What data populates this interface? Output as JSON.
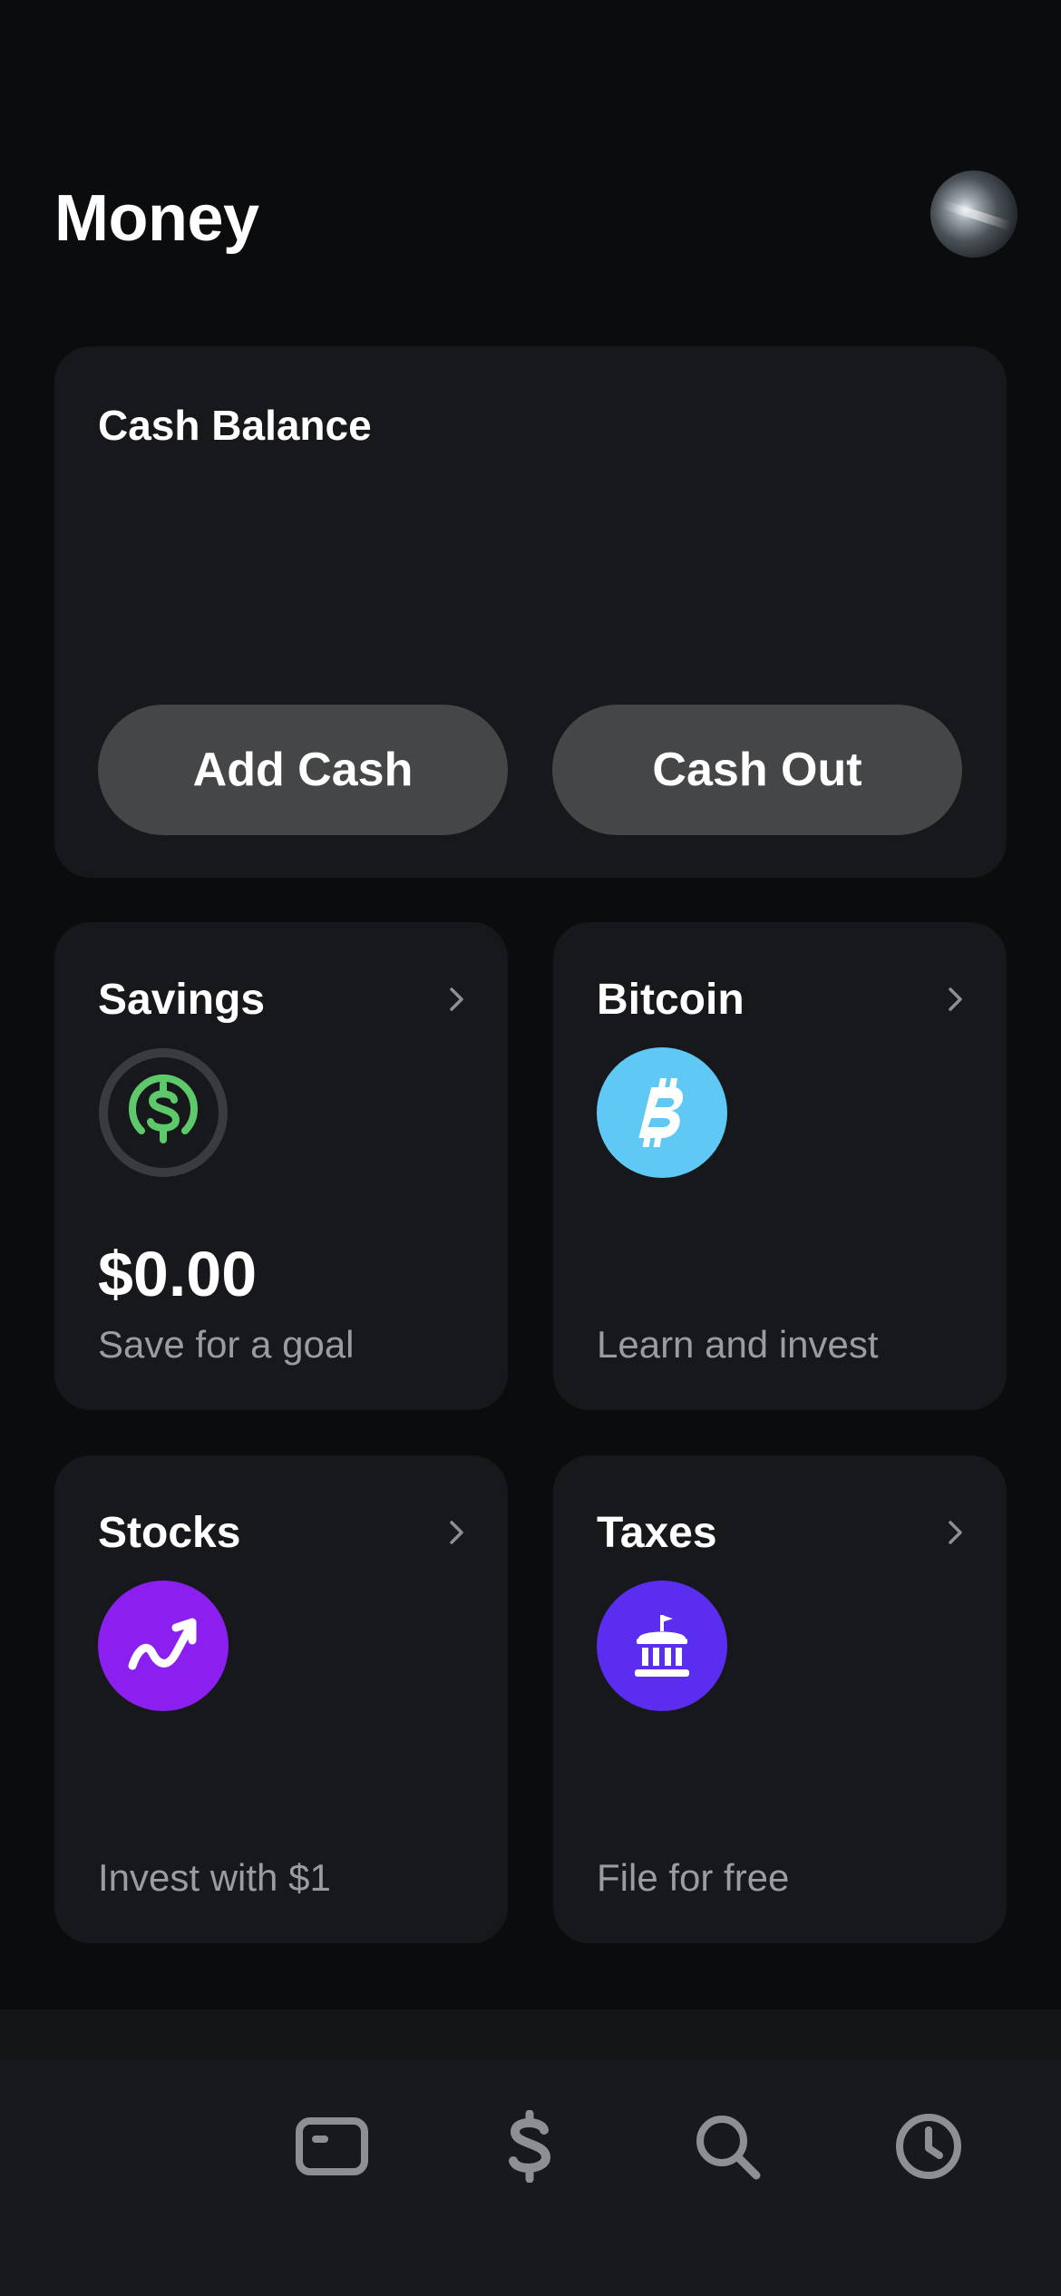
{
  "header": {
    "title": "Money"
  },
  "balance_card": {
    "title": "Cash Balance",
    "add_cash_label": "Add Cash",
    "cash_out_label": "Cash Out"
  },
  "tiles": [
    {
      "title": "Savings",
      "amount": "$0.00",
      "subtitle": "Save for a goal",
      "icon": "savings-dollar-icon",
      "icon_color": "#5ec96a"
    },
    {
      "title": "Bitcoin",
      "amount": "",
      "subtitle": "Learn and invest",
      "icon": "bitcoin-icon",
      "icon_color": "#5fc8f5"
    },
    {
      "title": "Stocks",
      "amount": "",
      "subtitle": "Invest with $1",
      "icon": "stocks-trend-icon",
      "icon_color": "#8a1ff0"
    },
    {
      "title": "Taxes",
      "amount": "",
      "subtitle": "File for free",
      "icon": "taxes-building-icon",
      "icon_color": "#5a2df0"
    }
  ],
  "bottom_nav": [
    {
      "icon": "money-card-icon"
    },
    {
      "icon": "dollar-icon"
    },
    {
      "icon": "search-icon"
    },
    {
      "icon": "clock-icon"
    }
  ],
  "colors": {
    "background": "#0b0c0e",
    "card": "#17181b",
    "button": "#454648",
    "muted_text": "#9b9ca0",
    "nav_icon": "#8e8f93"
  }
}
